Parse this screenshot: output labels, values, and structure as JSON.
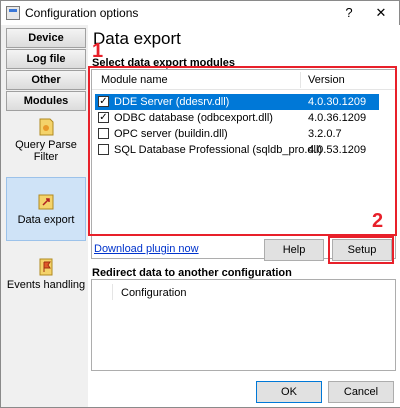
{
  "window": {
    "title": "Configuration options",
    "help_glyph": "?",
    "close_glyph": "✕"
  },
  "nav": {
    "buttons": [
      "Device",
      "Log file",
      "Other",
      "Modules"
    ],
    "items": [
      {
        "label": "Query Parse Filter",
        "icon": "filter-icon"
      },
      {
        "label": "Data export",
        "icon": "export-icon",
        "active": true
      },
      {
        "label": "Events handling",
        "icon": "flag-icon"
      }
    ]
  },
  "main": {
    "title": "Data export",
    "modules_label": "Select data export modules",
    "columns": {
      "name": "Module name",
      "version": "Version"
    },
    "modules": [
      {
        "name": "DDE Server (ddesrv.dll)",
        "version": "4.0.30.1209",
        "checked": true,
        "selected": true
      },
      {
        "name": "ODBC database (odbcexport.dll)",
        "version": "4.0.36.1209",
        "checked": true,
        "selected": false
      },
      {
        "name": "OPC server (buildin.dll)",
        "version": "3.2.0.7",
        "checked": false,
        "selected": false
      },
      {
        "name": "SQL Database Professional (sqldb_pro.dll)",
        "version": "4.0.53.1209",
        "checked": false,
        "selected": false
      }
    ],
    "download_link": "Download plugin now",
    "help_button": "Help",
    "setup_button": "Setup",
    "redirect_label": "Redirect data to another configuration",
    "config_column": "Configuration",
    "ok_button": "OK",
    "cancel_button": "Cancel"
  },
  "annotations": {
    "marker_1": "1",
    "marker_2": "2"
  },
  "colors": {
    "annotation": "#e8202a",
    "selection": "#0078d7",
    "link": "#0033cc"
  }
}
